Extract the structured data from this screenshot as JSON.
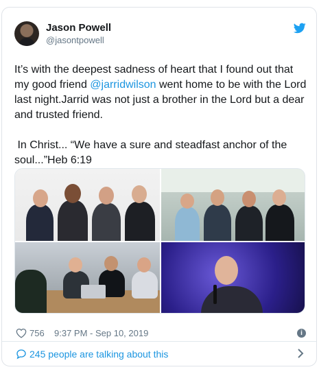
{
  "tweet": {
    "author_name": "Jason Powell",
    "author_handle": "@jasontpowell",
    "text_before_mention": "It’s with the deepest sadness of heart that I found out that my good friend ",
    "mention": "@jarridwilson",
    "text_after_mention": " went home to be with the Lord last night.Jarrid was not just a brother in the Lord but a dear and trusted friend.\n\n In Christ... “We have a sure and steadfast anchor of the soul...”Heb 6:19",
    "like_count": "756",
    "timestamp": "9:37 PM - Sep 10, 2019",
    "talking_link": "245 people are talking about this"
  },
  "icons": {
    "brand": "twitter-bird-icon",
    "like": "heart-icon",
    "info": "info-icon",
    "talk": "speech-bubble-icon",
    "more": "chevron-right-icon"
  },
  "colors": {
    "link": "#1b95e0",
    "secondary_text": "#657786",
    "border": "#e1e8ed"
  }
}
